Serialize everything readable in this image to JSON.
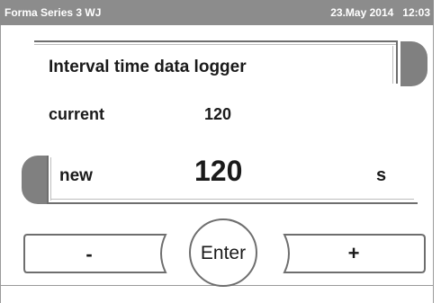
{
  "status_bar": {
    "device_name": "Forma Series 3 WJ",
    "date": "23.May 2014",
    "time": "12:03"
  },
  "title": "Interval time data logger",
  "current": {
    "label": "current",
    "value": "120"
  },
  "new": {
    "label": "new",
    "value": "120",
    "unit": "s"
  },
  "buttons": {
    "minus": "-",
    "enter": "Enter",
    "plus": "+"
  },
  "colors": {
    "status_bar": "#8c8c8c",
    "tab": "#808080",
    "line": "#6e6e6e",
    "text": "#1a1a1a"
  }
}
